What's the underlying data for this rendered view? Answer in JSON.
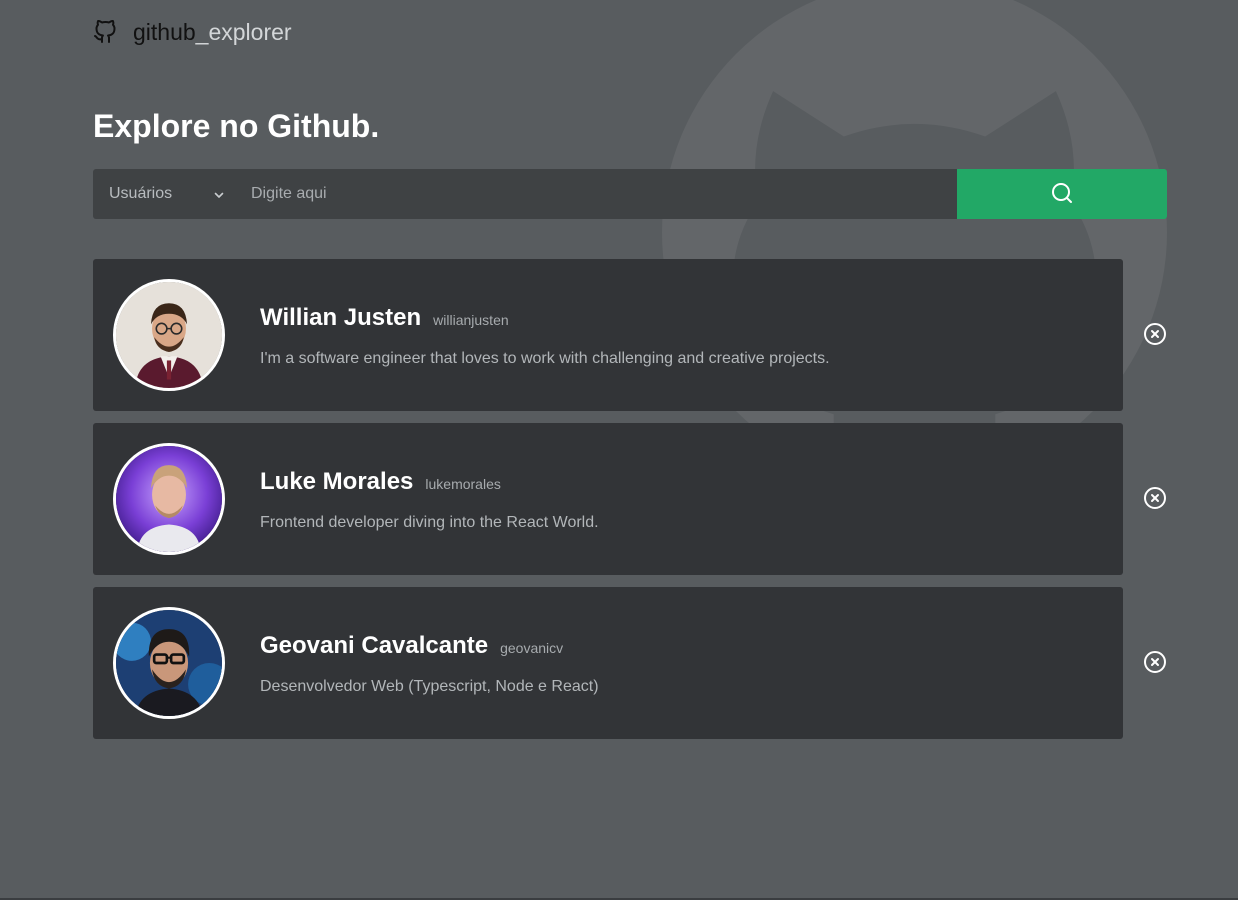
{
  "brand": {
    "part1": "github",
    "part2": "_explorer"
  },
  "heading": "Explore no Github.",
  "search": {
    "type_label": "Usuários",
    "placeholder": "Digite aqui",
    "value": ""
  },
  "users": [
    {
      "name": "Willian Justen",
      "login": "willianjusten",
      "bio": "I'm a software engineer that loves to work with challenging and creative projects."
    },
    {
      "name": "Luke Morales",
      "login": "lukemorales",
      "bio": "Frontend developer diving into the React World."
    },
    {
      "name": "Geovani Cavalcante",
      "login": "geovanicv",
      "bio": "Desenvolvedor Web (Typescript, Node e React)"
    }
  ],
  "colors": {
    "background": "#585c5f",
    "card": "#323437",
    "accent": "#22a866",
    "input": "#3f4244"
  },
  "icons": {
    "brand": "github-icon",
    "select": "chevron-down-icon",
    "search": "search-icon",
    "remove": "x-circle-icon"
  }
}
